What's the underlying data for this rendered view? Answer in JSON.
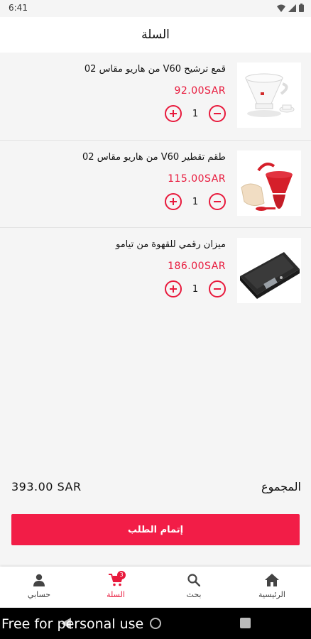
{
  "status_bar": {
    "time": "6:41"
  },
  "app_bar": {
    "title": "السلة"
  },
  "cart_items": [
    {
      "name": "قمع ترشيح V60 من هاريو مقاس 02",
      "price": "92.00SAR",
      "quantity": "1",
      "image": "v60-dripper-image"
    },
    {
      "name": "طقم تقطير V60 من هاريو مقاس 02",
      "price": "115.00SAR",
      "quantity": "1",
      "image": "v60-drip-set-image"
    },
    {
      "name": "ميزان رقمي للقهوة من تيامو",
      "price": "186.00SAR",
      "quantity": "1",
      "image": "digital-scale-image"
    }
  ],
  "summary": {
    "total_label": "المجموع",
    "total_amount": "393.00 SAR"
  },
  "checkout": {
    "label": "إتمام الطلب"
  },
  "bottom_nav": {
    "items": [
      {
        "label": "الرئيسية",
        "icon": "home-icon"
      },
      {
        "label": "بحث",
        "icon": "search-icon"
      },
      {
        "label": "السلة",
        "icon": "cart-icon",
        "active": true,
        "badge": "3"
      },
      {
        "label": "حسابي",
        "icon": "person-icon"
      }
    ]
  },
  "overlay": {
    "watermark": "Free for personal use"
  },
  "colors": {
    "accent": "#e8193c",
    "checkout_bg": "#f21d47",
    "background": "#f5f5f5"
  }
}
